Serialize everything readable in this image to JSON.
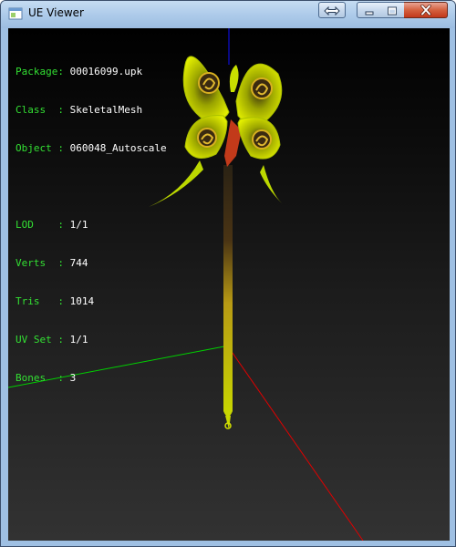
{
  "window": {
    "title": "UE Viewer"
  },
  "caption_buttons": {
    "fullscreen_icon": "double-arrow-icon",
    "minimize_icon": "minimize-icon",
    "maximize_icon": "maximize-icon",
    "close_icon": "close-icon"
  },
  "info": {
    "package": {
      "label": "Package",
      "value": "00016099.upk"
    },
    "class": {
      "label": "Class  ",
      "value": "SkeletalMesh"
    },
    "object": {
      "label": "Object ",
      "value": "060048_Autoscale"
    },
    "lod": {
      "label": "LOD    ",
      "value": "1/1"
    },
    "verts": {
      "label": "Verts  ",
      "value": "744"
    },
    "tris": {
      "label": "Tris   ",
      "value": "1014"
    },
    "uvset": {
      "label": "UV Set ",
      "value": "1/1"
    },
    "bones": {
      "label": "Bones  ",
      "value": "3"
    }
  },
  "colors": {
    "label_green": "#33e033",
    "axis_x": "#ff0000",
    "axis_y": "#00d000",
    "axis_z": "#0000ff",
    "mesh_yellow": "#c8e000"
  }
}
